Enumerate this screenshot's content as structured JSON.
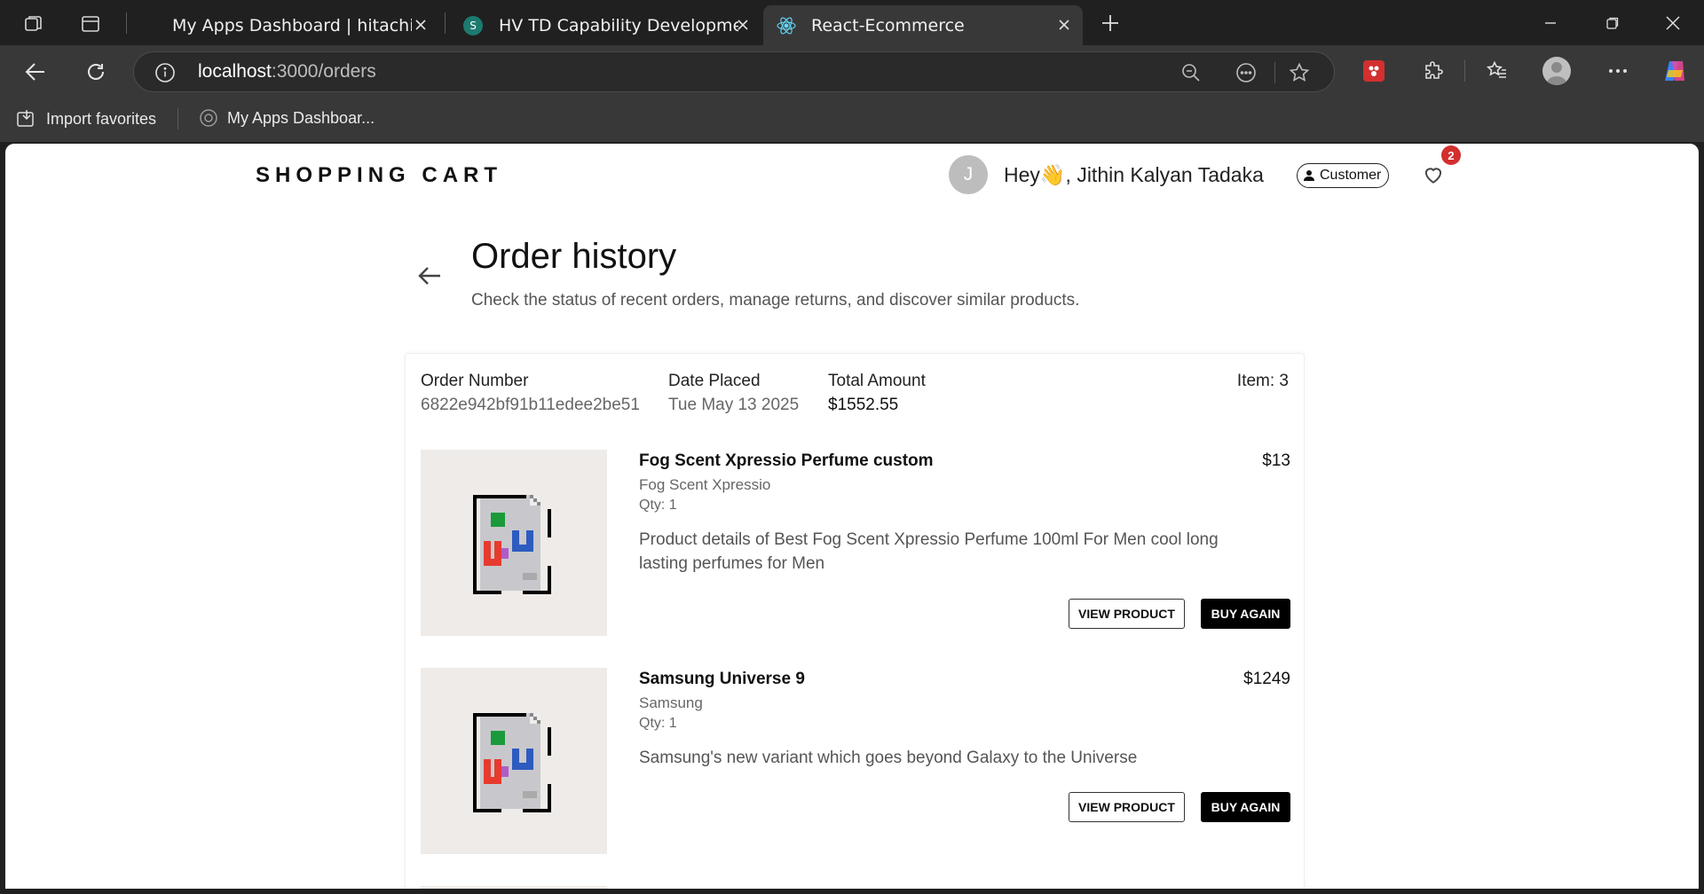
{
  "browser": {
    "tabs": [
      {
        "title": "My Apps Dashboard | hitachivanta",
        "active": false
      },
      {
        "title": "HV TD Capability Development (L",
        "active": false
      },
      {
        "title": "React-Ecommerce",
        "active": true
      }
    ],
    "url_host": "localhost",
    "url_path": ":3000/orders",
    "favorites": [
      {
        "label": "Import favorites"
      },
      {
        "label": "My Apps Dashboar..."
      }
    ]
  },
  "header": {
    "brand": "SHOPPING CART",
    "avatar_initial": "J",
    "greeting": "Hey👋, Jithin Kalyan Tadaka",
    "role": "Customer",
    "wishlist_count": "2"
  },
  "page": {
    "title": "Order history",
    "subtitle": "Check the status of recent orders, manage returns, and discover similar products."
  },
  "order": {
    "number_label": "Order Number",
    "number": "6822e942bf91b11edee2be51",
    "date_label": "Date Placed",
    "date": "Tue May 13 2025",
    "total_label": "Total Amount",
    "total": "$1552.55",
    "items_count": "Item: 3",
    "items": [
      {
        "name": "Fog Scent Xpressio Perfume custom",
        "brand": "Fog Scent Xpressio",
        "qty": "Qty: 1",
        "price": "$13",
        "description": "Product details of Best Fog Scent Xpressio Perfume 100ml For Men cool long lasting perfumes for Men"
      },
      {
        "name": "Samsung Universe 9",
        "brand": "Samsung",
        "qty": "Qty: 1",
        "price": "$1249",
        "description": "Samsung's new variant which goes beyond Galaxy to the Universe"
      }
    ],
    "view_label": "VIEW PRODUCT",
    "buy_label": "BUY AGAIN"
  }
}
